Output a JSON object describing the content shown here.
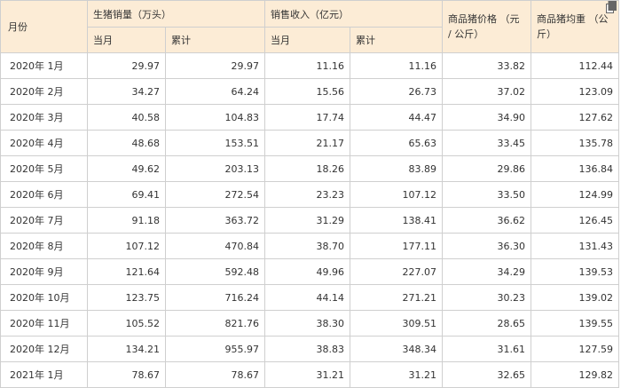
{
  "table": {
    "header": {
      "month": "月份",
      "hog_sales": "生猪销量（万头）",
      "revenue": "销售收入（亿元）",
      "price": "商品猪价格 （元 / 公斤）",
      "weight": "商品猪均重 （公斤）",
      "current_month": "当月",
      "cumulative": "累计"
    },
    "rows": [
      {
        "month": "2020年 1月",
        "sales_month": "29.97",
        "sales_cum": "29.97",
        "revenue_month": "11.16",
        "revenue_cum": "11.16",
        "price": "33.82",
        "weight": "112.44"
      },
      {
        "month": "2020年 2月",
        "sales_month": "34.27",
        "sales_cum": "64.24",
        "revenue_month": "15.56",
        "revenue_cum": "26.73",
        "price": "37.02",
        "weight": "123.09"
      },
      {
        "month": "2020年 3月",
        "sales_month": "40.58",
        "sales_cum": "104.83",
        "revenue_month": "17.74",
        "revenue_cum": "44.47",
        "price": "34.90",
        "weight": "127.62"
      },
      {
        "month": "2020年 4月",
        "sales_month": "48.68",
        "sales_cum": "153.51",
        "revenue_month": "21.17",
        "revenue_cum": "65.63",
        "price": "33.45",
        "weight": "135.78"
      },
      {
        "month": "2020年 5月",
        "sales_month": "49.62",
        "sales_cum": "203.13",
        "revenue_month": "18.26",
        "revenue_cum": "83.89",
        "price": "29.86",
        "weight": "136.84"
      },
      {
        "month": "2020年 6月",
        "sales_month": "69.41",
        "sales_cum": "272.54",
        "revenue_month": "23.23",
        "revenue_cum": "107.12",
        "price": "33.50",
        "weight": "124.99"
      },
      {
        "month": "2020年 7月",
        "sales_month": "91.18",
        "sales_cum": "363.72",
        "revenue_month": "31.29",
        "revenue_cum": "138.41",
        "price": "36.62",
        "weight": "126.45"
      },
      {
        "month": "2020年 8月",
        "sales_month": "107.12",
        "sales_cum": "470.84",
        "revenue_month": "38.70",
        "revenue_cum": "177.11",
        "price": "36.30",
        "weight": "131.43"
      },
      {
        "month": "2020年 9月",
        "sales_month": "121.64",
        "sales_cum": "592.48",
        "revenue_month": "49.96",
        "revenue_cum": "227.07",
        "price": "34.29",
        "weight": "139.53"
      },
      {
        "month": "2020年 10月",
        "sales_month": "123.75",
        "sales_cum": "716.24",
        "revenue_month": "44.14",
        "revenue_cum": "271.21",
        "price": "30.23",
        "weight": "139.02"
      },
      {
        "month": "2020年 11月",
        "sales_month": "105.52",
        "sales_cum": "821.76",
        "revenue_month": "38.30",
        "revenue_cum": "309.51",
        "price": "28.65",
        "weight": "139.55"
      },
      {
        "month": "2020年 12月",
        "sales_month": "134.21",
        "sales_cum": "955.97",
        "revenue_month": "38.83",
        "revenue_cum": "348.34",
        "price": "31.61",
        "weight": "127.59"
      },
      {
        "month": "2021年 1月",
        "sales_month": "78.67",
        "sales_cum": "78.67",
        "revenue_month": "31.21",
        "revenue_cum": "31.21",
        "price": "32.65",
        "weight": "129.82"
      }
    ]
  },
  "icons": {
    "corner": "copy-icon"
  }
}
